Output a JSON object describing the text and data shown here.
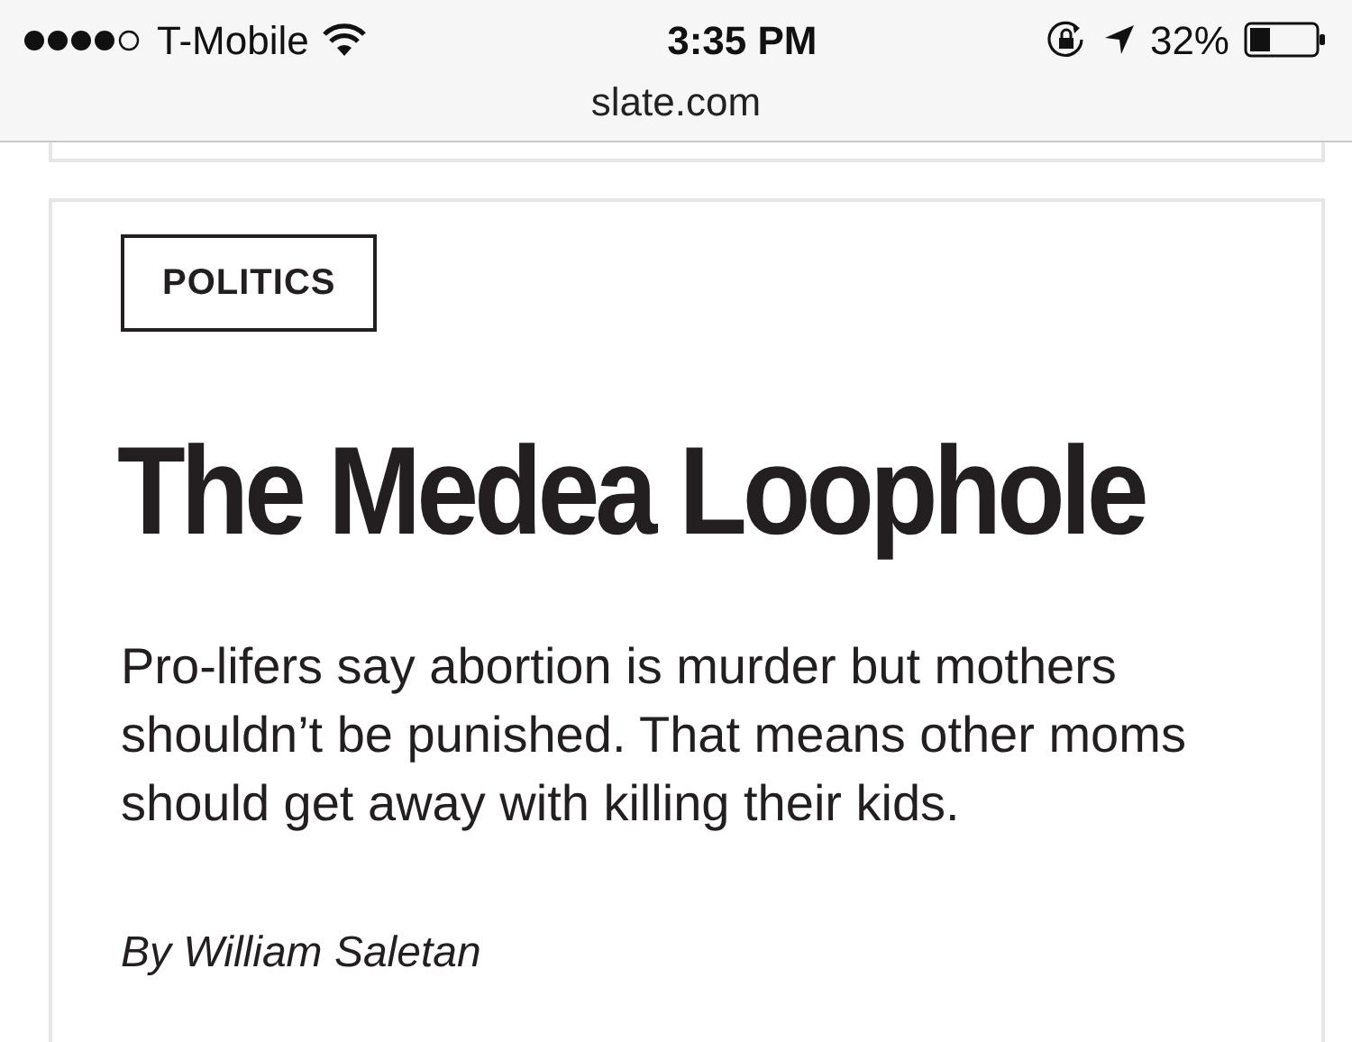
{
  "status_bar": {
    "carrier": "T-Mobile",
    "time": "3:35 PM",
    "battery": "32%"
  },
  "address_bar": {
    "url": "slate.com"
  },
  "article": {
    "category": "POLITICS",
    "headline": "The Medea Loophole",
    "dek": "Pro-lifers say abortion is murder but mothers shouldn’t be punished. That means other moms should get away with killing their kids.",
    "byline": "By William Saletan"
  }
}
